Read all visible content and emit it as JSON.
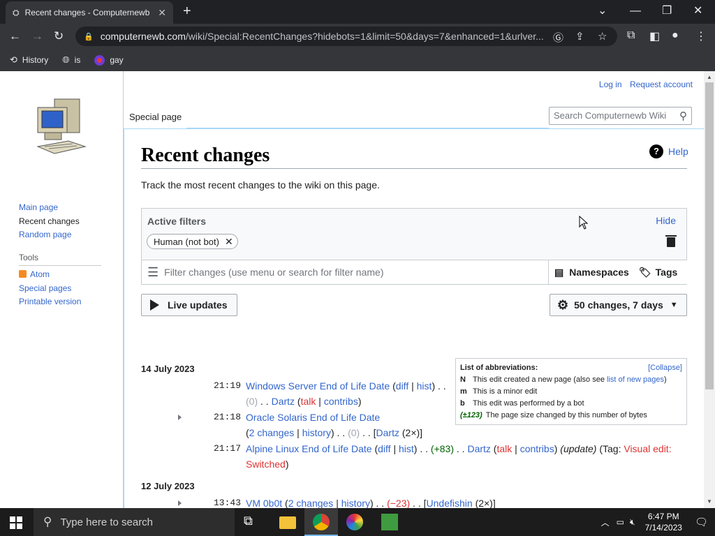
{
  "browser": {
    "tab_title": "Recent changes - Computernewb",
    "tab_close": "✕",
    "new_tab": "+",
    "url_domain": "computernewb.com",
    "url_path": "/wiki/Special:RecentChanges?hidebots=1&limit=50&days=7&enhanced=1&urlver...",
    "bookmarks": [
      {
        "label": "History",
        "icon": "history-icon"
      },
      {
        "label": "is",
        "icon": "globe-icon"
      },
      {
        "label": "gay",
        "icon": "colorful-circle-icon"
      }
    ]
  },
  "wiki": {
    "personal": {
      "login": "Log in",
      "request": "Request account"
    },
    "tab_special": "Special page",
    "search_placeholder": "Search Computernewb Wiki",
    "nav": {
      "main": "Main page",
      "recent": "Recent changes",
      "random": "Random page"
    },
    "tools": {
      "heading": "Tools",
      "atom": "Atom",
      "special": "Special pages",
      "printable": "Printable version"
    },
    "title": "Recent changes",
    "help": "Help",
    "description": "Track the most recent changes to the wiki on this page.",
    "filters": {
      "active_label": "Active filters",
      "hide": "Hide",
      "chip": "Human (not bot)",
      "input_placeholder": "Filter changes (use menu or search for filter name)",
      "namespaces": "Namespaces",
      "tags": "Tags"
    },
    "live_updates": "Live updates",
    "changes_summary": "50 changes, 7 days",
    "legend": {
      "heading": "List of abbreviations:",
      "collapse": "[Collapse]",
      "n_key": "N",
      "n_text": "This edit created a new page (also see ",
      "n_link": "list of new pages",
      "n_end": ")",
      "m_key": "m",
      "m_text": "This is a minor edit",
      "b_key": "b",
      "b_text": "This edit was performed by a bot",
      "size_key": "(±123)",
      "size_text": "The page size changed by this number of bytes"
    },
    "days": [
      {
        "date": "14 July 2023",
        "entries": [
          {
            "time": "21:19",
            "page": "Windows Server End of Life Date",
            "diff": "diff",
            "hist": "hist",
            "size": "(0)",
            "user": "Dartz",
            "talk": "talk",
            "contribs": "contribs"
          },
          {
            "time": "21:18",
            "page": "Oracle Solaris End of Life Date",
            "changes": "2 changes",
            "history": "history",
            "size": "(0)",
            "user": "Dartz",
            "count": "(2×)"
          },
          {
            "time": "21:17",
            "page": "Alpine Linux End of Life Date",
            "diff": "diff",
            "hist": "hist",
            "size": "(+83)",
            "user": "Dartz",
            "talk": "talk",
            "contribs": "contribs",
            "summary": "(update)",
            "tag_label": "Tag: ",
            "tag": "Visual edit: Switched"
          }
        ]
      },
      {
        "date": "12 July 2023",
        "entries": [
          {
            "time": "13:43",
            "page": "VM 0b0t",
            "changes": "2 changes",
            "history": "history",
            "size": "(−23)",
            "user": "Undefishin",
            "count": "(2×)"
          }
        ]
      }
    ]
  },
  "taskbar": {
    "search_placeholder": "Type here to search",
    "time": "6:47 PM",
    "date": "7/14/2023"
  }
}
